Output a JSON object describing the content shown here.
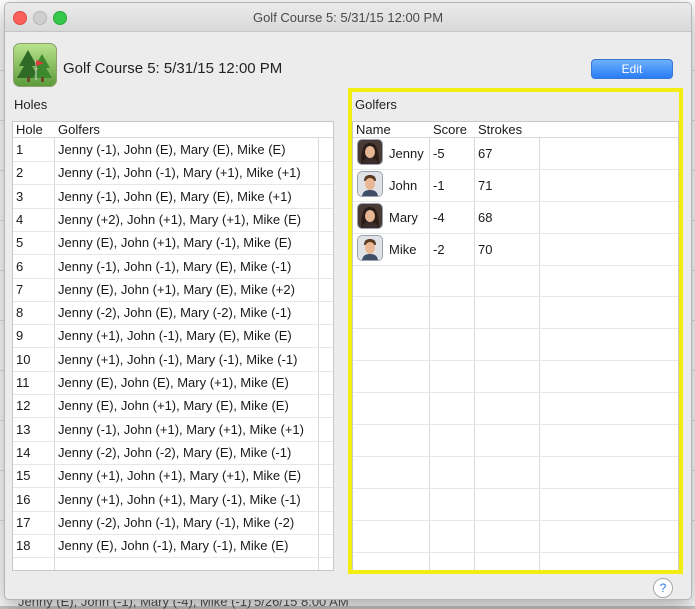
{
  "window": {
    "title": "Golf Course 5: 5/31/15 12:00 PM"
  },
  "header": {
    "course_title": "Golf Course 5: 5/31/15 12:00 PM",
    "edit_label": "Edit"
  },
  "holes": {
    "label": "Holes",
    "columns": [
      "Hole",
      "Golfers"
    ],
    "rows": [
      {
        "hole": "1",
        "golfers": "Jenny (-1), John (E), Mary (E), Mike (E)"
      },
      {
        "hole": "2",
        "golfers": "Jenny (-1), John (-1), Mary (+1), Mike (+1)"
      },
      {
        "hole": "3",
        "golfers": "Jenny (-1), John (E), Mary (E), Mike (+1)"
      },
      {
        "hole": "4",
        "golfers": "Jenny (+2), John (+1), Mary (+1), Mike (E)"
      },
      {
        "hole": "5",
        "golfers": "Jenny (E), John (+1), Mary (-1), Mike (E)"
      },
      {
        "hole": "6",
        "golfers": "Jenny (-1), John (-1), Mary (E), Mike (-1)"
      },
      {
        "hole": "7",
        "golfers": "Jenny (E), John (+1), Mary (E), Mike (+2)"
      },
      {
        "hole": "8",
        "golfers": "Jenny (-2), John (E), Mary (-2), Mike (-1)"
      },
      {
        "hole": "9",
        "golfers": "Jenny (+1), John (-1), Mary (E), Mike (E)"
      },
      {
        "hole": "10",
        "golfers": "Jenny (+1), John (-1), Mary (-1), Mike (-1)"
      },
      {
        "hole": "11",
        "golfers": "Jenny (E), John (E), Mary (+1), Mike (E)"
      },
      {
        "hole": "12",
        "golfers": "Jenny (E), John (+1), Mary (E), Mike (E)"
      },
      {
        "hole": "13",
        "golfers": "Jenny (-1), John (+1), Mary (+1), Mike (+1)"
      },
      {
        "hole": "14",
        "golfers": "Jenny (-2), John (-2), Mary (E), Mike (-1)"
      },
      {
        "hole": "15",
        "golfers": "Jenny (+1), John (+1), Mary (+1), Mike (E)"
      },
      {
        "hole": "16",
        "golfers": "Jenny (+1), John (+1), Mary (-1), Mike (-1)"
      },
      {
        "hole": "17",
        "golfers": "Jenny (-2), John (-1), Mary (-1), Mike (-2)"
      },
      {
        "hole": "18",
        "golfers": "Jenny (E), John (-1), Mary (-1), Mike (E)"
      }
    ]
  },
  "golfers": {
    "label": "Golfers",
    "columns": [
      "Name",
      "Score",
      "Strokes"
    ],
    "rows": [
      {
        "name": "Jenny",
        "score": "-5",
        "strokes": "67",
        "avatar": "female-avatar-icon"
      },
      {
        "name": "John",
        "score": "-1",
        "strokes": "71",
        "avatar": "male-avatar-icon"
      },
      {
        "name": "Mary",
        "score": "-4",
        "strokes": "68",
        "avatar": "female-avatar-icon"
      },
      {
        "name": "Mike",
        "score": "-2",
        "strokes": "70",
        "avatar": "male-avatar-icon"
      }
    ]
  },
  "highlight_color": "#f2ee12",
  "accent_color": "#2a7cf3",
  "background_window": {
    "partial_row": "Jenny (E), John (-1), Mary (-4), Mike (-1)",
    "partial_timestamp": "5/26/15 8:00 AM"
  },
  "help_label": "?"
}
